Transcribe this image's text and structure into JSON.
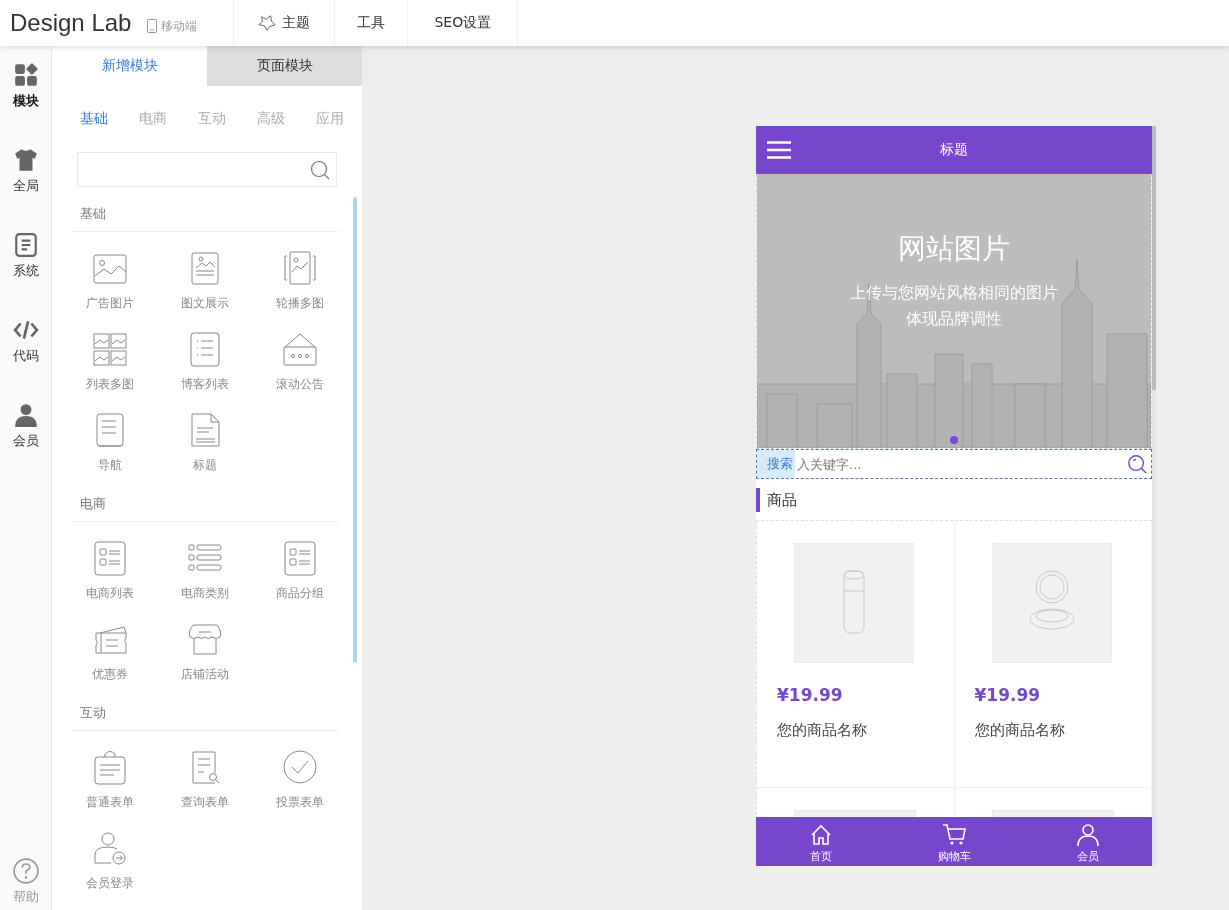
{
  "app": {
    "brand": "Design Lab",
    "device": "移动端"
  },
  "top_tabs": [
    {
      "label": "主题"
    },
    {
      "label": "工具"
    },
    {
      "label": "SEO设置"
    }
  ],
  "rail": {
    "items": [
      {
        "label": "模块",
        "selected": true
      },
      {
        "label": "全局",
        "selected": false
      },
      {
        "label": "系统",
        "selected": false
      },
      {
        "label": "代码",
        "selected": false
      },
      {
        "label": "会员",
        "selected": false
      }
    ],
    "help": "帮助"
  },
  "panel": {
    "tabs": [
      {
        "label": "新增模块",
        "selected": true
      },
      {
        "label": "页面模块",
        "selected": false
      }
    ],
    "categories": [
      {
        "label": "基础",
        "selected": true
      },
      {
        "label": "电商",
        "selected": false
      },
      {
        "label": "互动",
        "selected": false
      },
      {
        "label": "高级",
        "selected": false
      },
      {
        "label": "应用",
        "selected": false
      }
    ],
    "sections": [
      {
        "title": "基础",
        "items": [
          "广告图片",
          "图文展示",
          "轮播多图",
          "列表多图",
          "博客列表",
          "滚动公告",
          "导航",
          "标题"
        ]
      },
      {
        "title": "电商",
        "items": [
          "电商列表",
          "电商类别",
          "商品分组",
          "优惠券",
          "店铺活动"
        ]
      },
      {
        "title": "互动",
        "items": [
          "普通表单",
          "查询表单",
          "投票表单",
          "会员登录"
        ]
      }
    ]
  },
  "phone": {
    "title": "标题",
    "banner": {
      "heading": "网站图片",
      "lines": [
        "上传与您网站风格相同的图片",
        "体现品牌调性"
      ],
      "dots": [
        {
          "selected": true
        }
      ]
    },
    "search": {
      "label": "搜索",
      "placeholder": "入关键字..."
    },
    "section_title": "商品",
    "products": [
      {
        "price": "¥19.99",
        "name": "您的商品名称"
      },
      {
        "price": "¥19.99",
        "name": "您的商品名称"
      }
    ],
    "nav": [
      {
        "label": "首页"
      },
      {
        "label": "购物车"
      },
      {
        "label": "会员"
      }
    ]
  }
}
